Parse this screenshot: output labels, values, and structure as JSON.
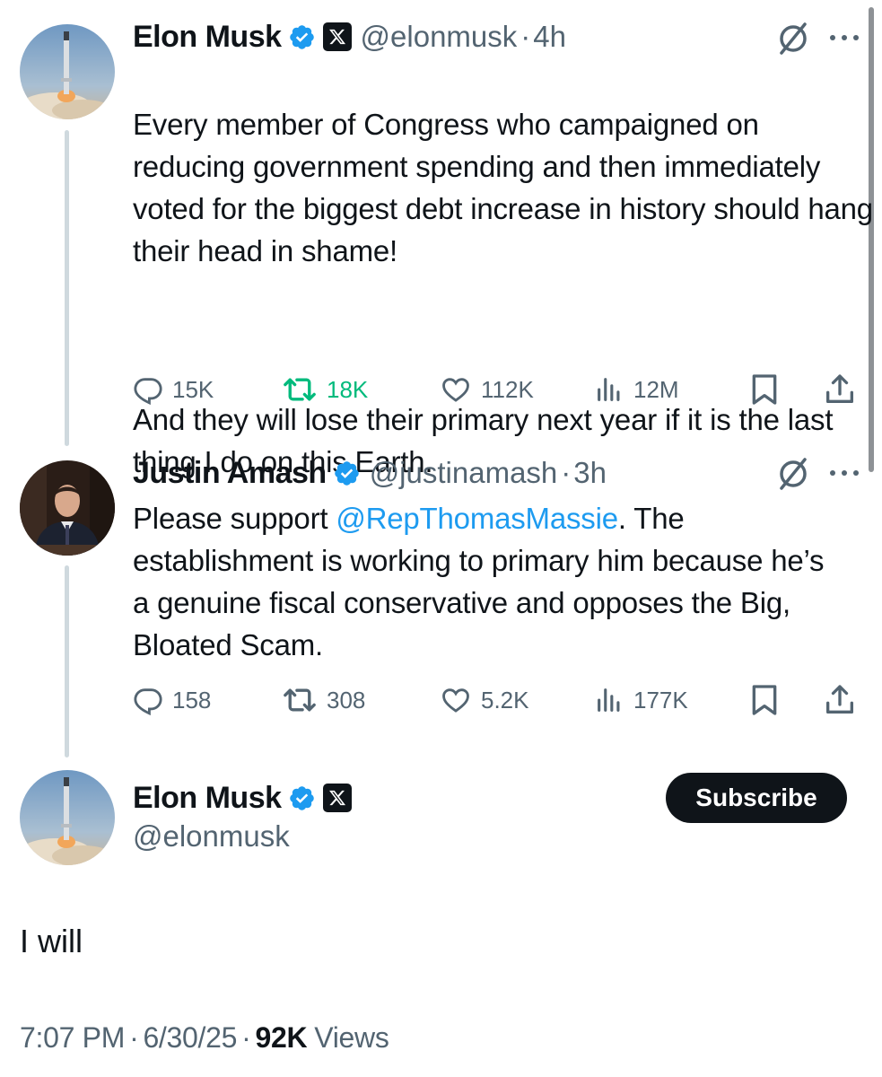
{
  "thread": [
    {
      "name": "Elon Musk",
      "handle": "@elonmusk",
      "separator": "·",
      "time": "4h",
      "paragraphs": [
        "Every member of Congress who campaigned on reducing government spending and then immediately voted for the biggest debt increase in history should hang their head in shame!",
        "And they will lose their primary next year if it is the last thing I do on this Earth."
      ],
      "stats": {
        "replies": "15K",
        "reposts": "18K",
        "likes": "112K",
        "views": "12M"
      },
      "reposted_by_viewer": true
    },
    {
      "name": "Justin Amash",
      "handle": "@justinamash",
      "separator": "·",
      "time": "3h",
      "text_before_mention": "Please support ",
      "mention": "@RepThomasMassie",
      "text_after_mention": ". The establishment is working to primary him because he’s a genuine fiscal conservative and opposes the Big, Bloated Scam.",
      "stats": {
        "replies": "158",
        "reposts": "308",
        "likes": "5.2K",
        "views": "177K"
      },
      "reposted_by_viewer": false
    }
  ],
  "main_post": {
    "name": "Elon Musk",
    "handle": "@elonmusk",
    "subscribe_label": "Subscribe",
    "text": "I will",
    "time": "7:07 PM",
    "date": "6/30/25",
    "separator": "·",
    "views_count": "92K",
    "views_label": "Views"
  },
  "icons": {
    "verified": "verified-badge-icon",
    "affiliate": "x-logo-icon",
    "grok": "grok-icon",
    "more": "more-icon",
    "reply": "reply-icon",
    "repost": "repost-icon",
    "like": "like-icon",
    "views": "views-icon",
    "bookmark": "bookmark-icon",
    "share": "share-icon"
  },
  "colors": {
    "text": "#0f1419",
    "secondary": "#536471",
    "link": "#1d9bf0",
    "verified": "#1d9bf0",
    "repost_active": "#00ba7c",
    "thread_line": "#cfd9de"
  }
}
